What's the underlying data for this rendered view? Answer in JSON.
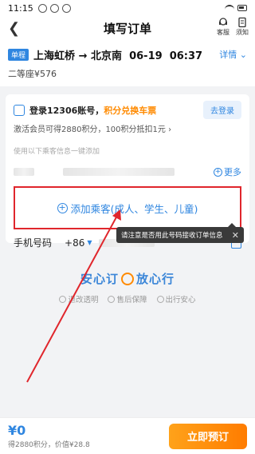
{
  "status_bar": {
    "time": "11:15"
  },
  "header": {
    "title": "填写订单",
    "service_label": "客服",
    "remind_label": "须知"
  },
  "trip": {
    "tag": "单程",
    "from": "上海虹桥",
    "arrow": "→",
    "to": "北京南",
    "date": "06-19",
    "time": "06:37",
    "detail_label": "详情",
    "seat": "二等座¥576"
  },
  "login": {
    "title": "登录12306账号，",
    "accent": "积分兑换车票",
    "subtitle": "激活会员可得2880积分，100积分抵扣1元",
    "button": "去登录"
  },
  "passengers": {
    "hint": "使用以下乘客信息一键添加",
    "more_label": "更多",
    "add_label": "添加乘客(成人、学生、儿童)"
  },
  "phone": {
    "label": "手机号码",
    "code": "+86"
  },
  "tooltip": {
    "text": "请注意是否用此号码接收订单信息"
  },
  "assurance": {
    "left": "安心订",
    "right": "放心行",
    "items": [
      "退改透明",
      "售后保障",
      "出行安心"
    ]
  },
  "bottom": {
    "price": "¥0",
    "sub": "得2880积分，价值¥28.8",
    "button": "立即预订"
  },
  "colors": {
    "accent_blue": "#2f86e0",
    "orange": "#ff8a00",
    "highlight_red": "#e0262c"
  }
}
